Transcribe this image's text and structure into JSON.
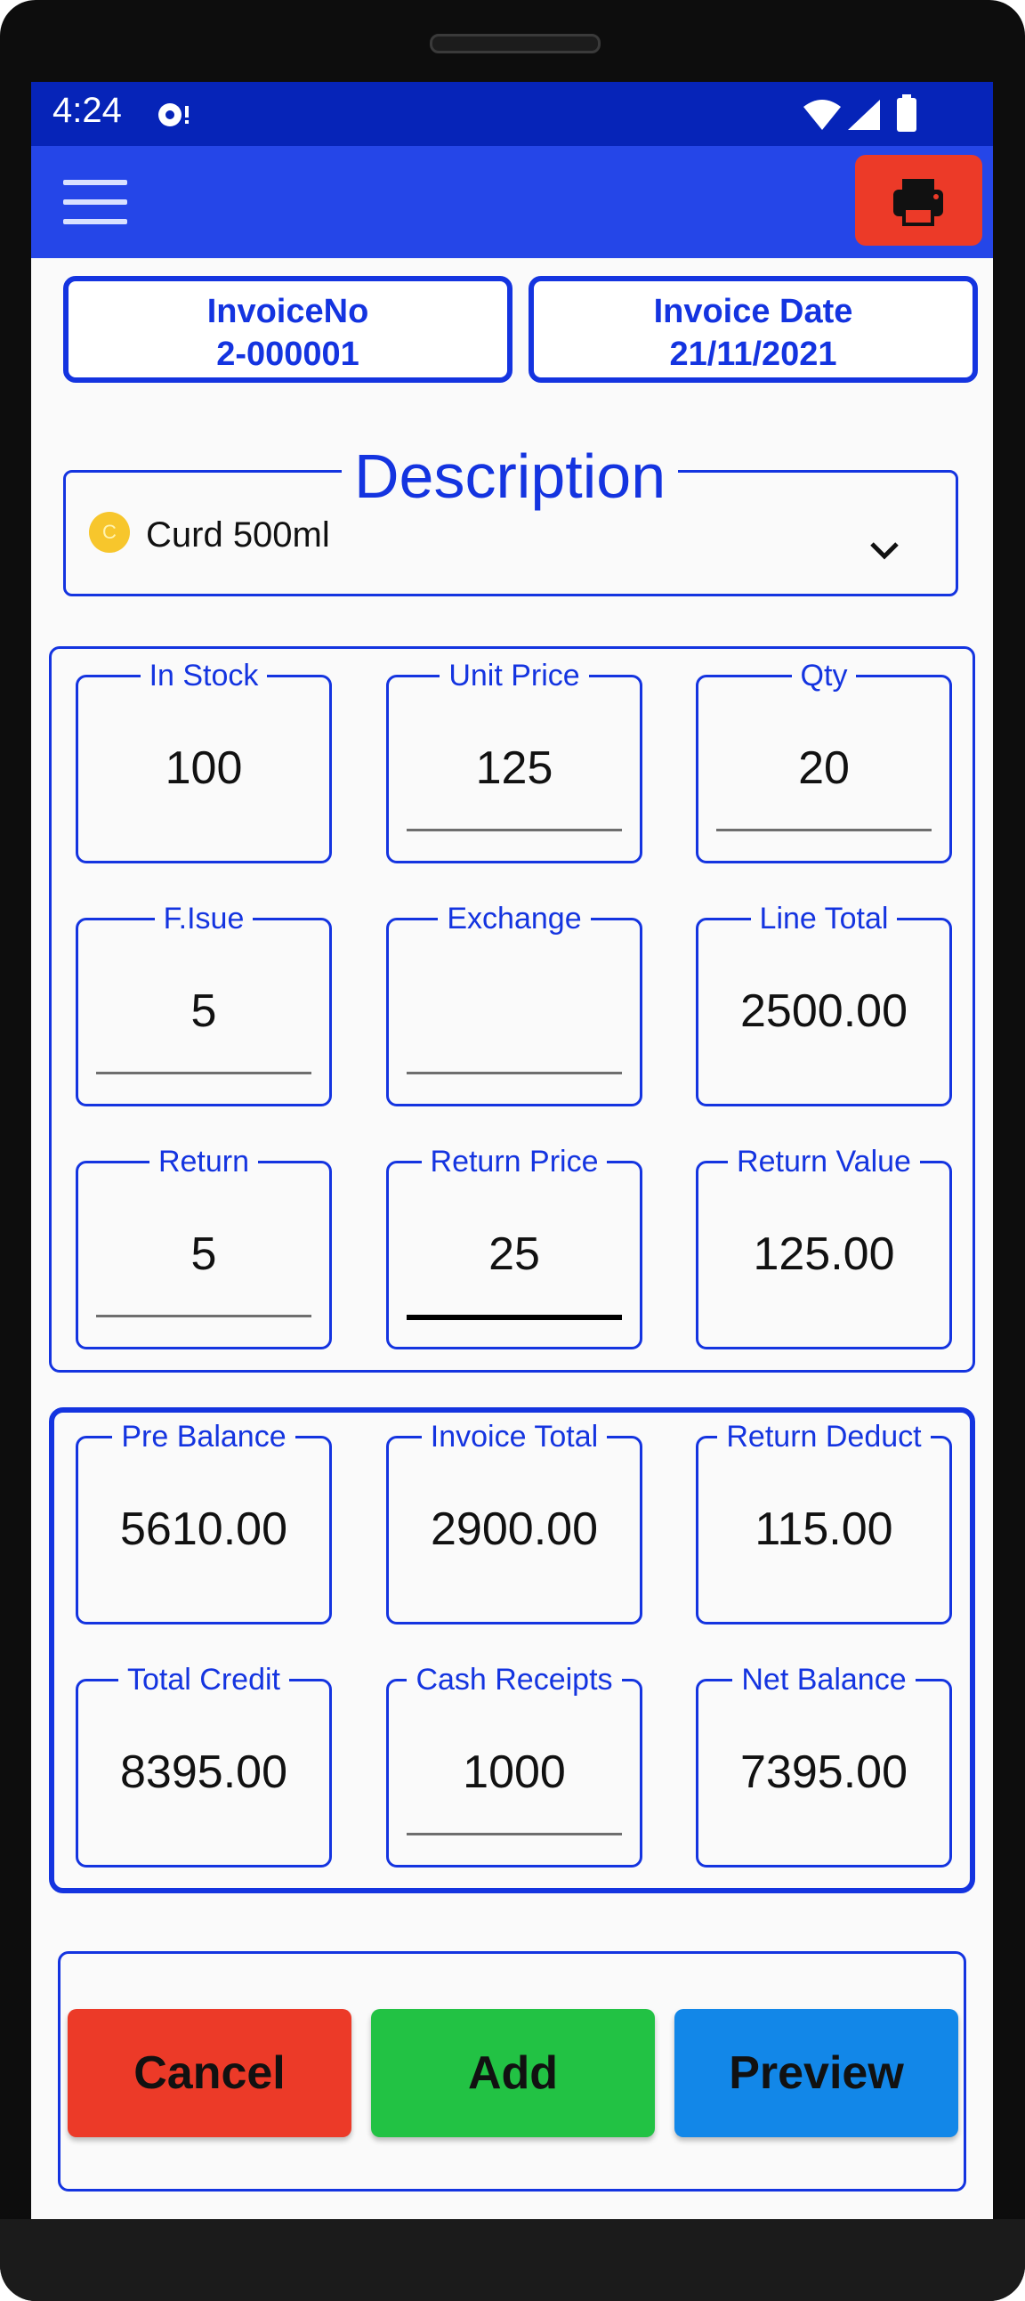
{
  "status_bar": {
    "time": "4:24"
  },
  "invoice_no": {
    "label": "InvoiceNo",
    "value": "2-000001"
  },
  "invoice_date": {
    "label": "Invoice Date",
    "value": "21/11/2021"
  },
  "description": {
    "label": "Description",
    "selected": "Curd 500ml",
    "coin_letter": "C"
  },
  "line_fields": {
    "in_stock": {
      "label": "In Stock",
      "value": "100"
    },
    "unit_price": {
      "label": "Unit Price",
      "value": "125"
    },
    "qty": {
      "label": "Qty",
      "value": "20"
    },
    "f_issue": {
      "label": "F.Isue",
      "value": "5"
    },
    "exchange": {
      "label": "Exchange",
      "value": ""
    },
    "line_total": {
      "label": "Line Total",
      "value": "2500.00"
    },
    "return": {
      "label": "Return",
      "value": "5"
    },
    "return_price": {
      "label": "Return Price",
      "value": "25"
    },
    "return_value": {
      "label": "Return Value",
      "value": "125.00"
    }
  },
  "summary_fields": {
    "pre_balance": {
      "label": "Pre Balance",
      "value": "5610.00"
    },
    "invoice_total": {
      "label": "Invoice Total",
      "value": "2900.00"
    },
    "return_deduct": {
      "label": "Return Deduct",
      "value": "115.00"
    },
    "total_credit": {
      "label": "Total Credit",
      "value": "8395.00"
    },
    "cash_receipts": {
      "label": "Cash Receipts",
      "value": "1000"
    },
    "net_balance": {
      "label": "Net Balance",
      "value": "7395.00"
    }
  },
  "buttons": {
    "cancel": "Cancel",
    "add": "Add",
    "preview": "Preview"
  },
  "colors": {
    "primary": "#1434e0",
    "appbar": "#2546e8",
    "statusbar": "#0624b8",
    "cancel": "#ec3a28",
    "add": "#22c244",
    "preview": "#1287e8"
  },
  "icons": [
    "menu-icon",
    "print-icon",
    "wifi-icon",
    "signal-icon",
    "battery-icon",
    "chevron-down-icon",
    "coin-icon"
  ]
}
